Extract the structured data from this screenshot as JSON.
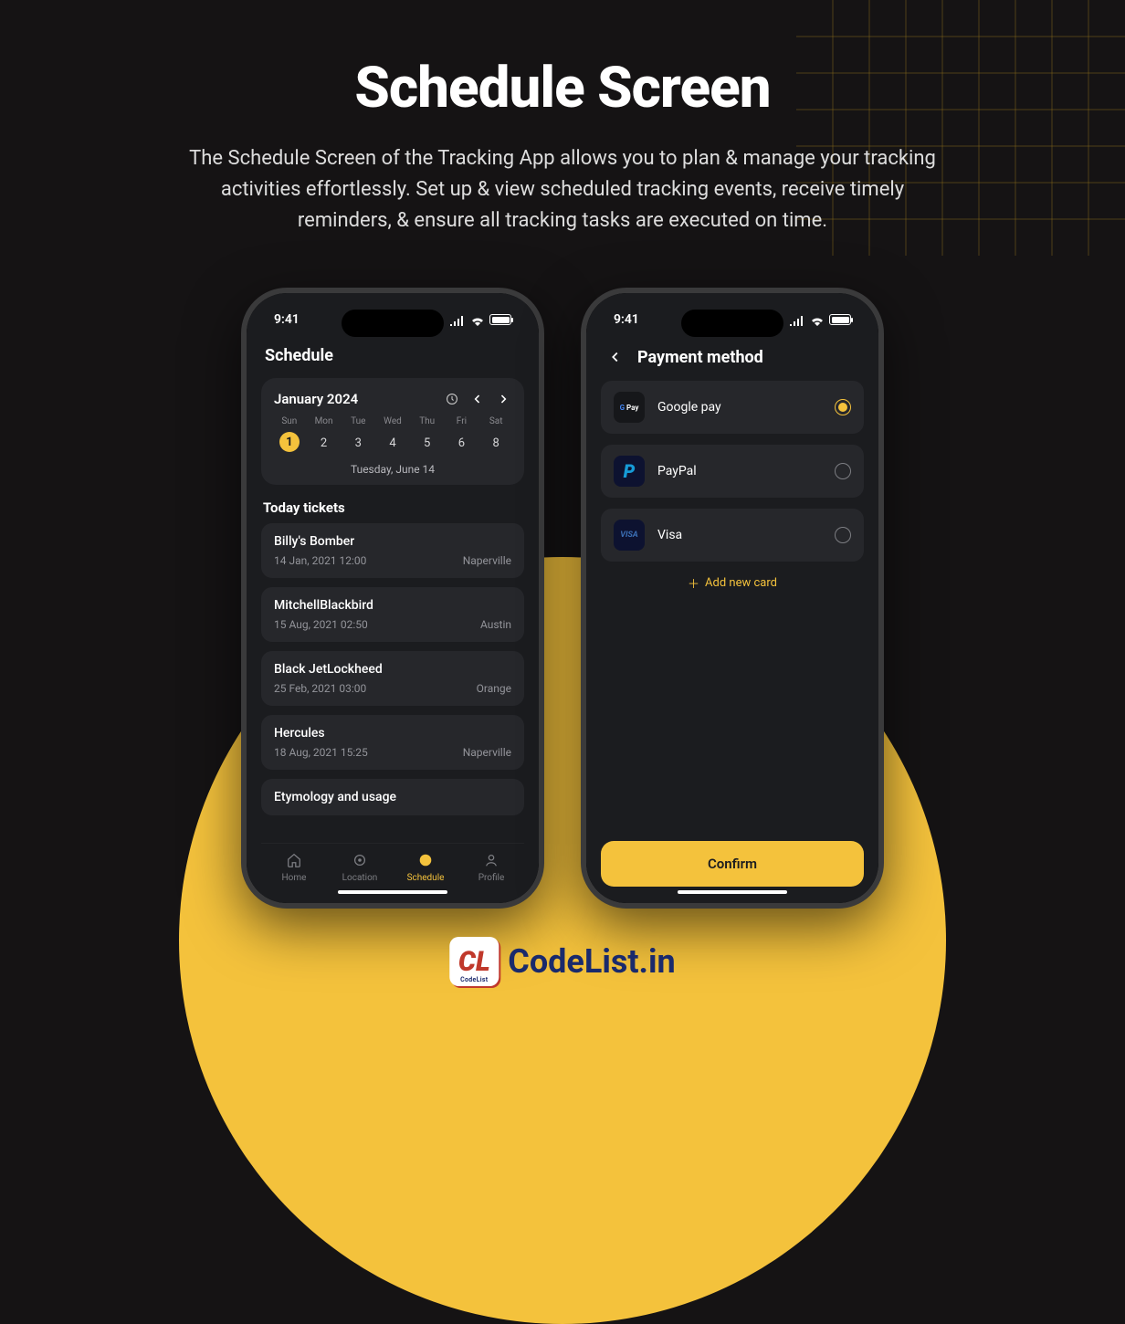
{
  "hero": {
    "title": "Schedule Screen",
    "description": "The Schedule Screen of the Tracking App allows you to plan & manage your tracking activities effortlessly. Set up & view scheduled tracking events, receive timely reminders, & ensure all tracking tasks are executed on time."
  },
  "status": {
    "time": "9:41"
  },
  "phone1": {
    "title": "Schedule",
    "calendar": {
      "month_label": "January 2024",
      "weekdays": [
        "Sun",
        "Mon",
        "Tue",
        "Wed",
        "Thu",
        "Fri",
        "Sat"
      ],
      "days": [
        {
          "n": "1",
          "selected": true
        },
        {
          "n": "2"
        },
        {
          "n": "3"
        },
        {
          "n": "4"
        },
        {
          "n": "5"
        },
        {
          "n": "6"
        },
        {
          "n": "8"
        }
      ],
      "footer": "Tuesday, June 14"
    },
    "tickets_label": "Today tickets",
    "tickets": [
      {
        "name": "Billy's Bomber",
        "date": "14 Jan, 2021 12:00",
        "city": "Naperville"
      },
      {
        "name": "MitchellBlackbird",
        "date": "15 Aug, 2021 02:50",
        "city": "Austin"
      },
      {
        "name": "Black JetLockheed",
        "date": "25 Feb, 2021 03:00",
        "city": "Orange"
      },
      {
        "name": "Hercules",
        "date": "18 Aug, 2021 15:25",
        "city": "Naperville"
      },
      {
        "name": "Etymology and usage",
        "date": "",
        "city": ""
      }
    ],
    "tabs": [
      {
        "label": "Home"
      },
      {
        "label": "Location"
      },
      {
        "label": "Schedule",
        "active": true
      },
      {
        "label": "Profile"
      }
    ]
  },
  "phone2": {
    "title": "Payment method",
    "methods": [
      {
        "name": "Google pay",
        "logo": "gpay",
        "selected": true
      },
      {
        "name": "PayPal",
        "logo": "paypal",
        "selected": false
      },
      {
        "name": "Visa",
        "logo": "visa",
        "selected": false
      }
    ],
    "add_label": "Add new card",
    "confirm_label": "Confirm"
  },
  "footer": {
    "brand": "CodeList.in",
    "badge_sub": "CodeList"
  }
}
